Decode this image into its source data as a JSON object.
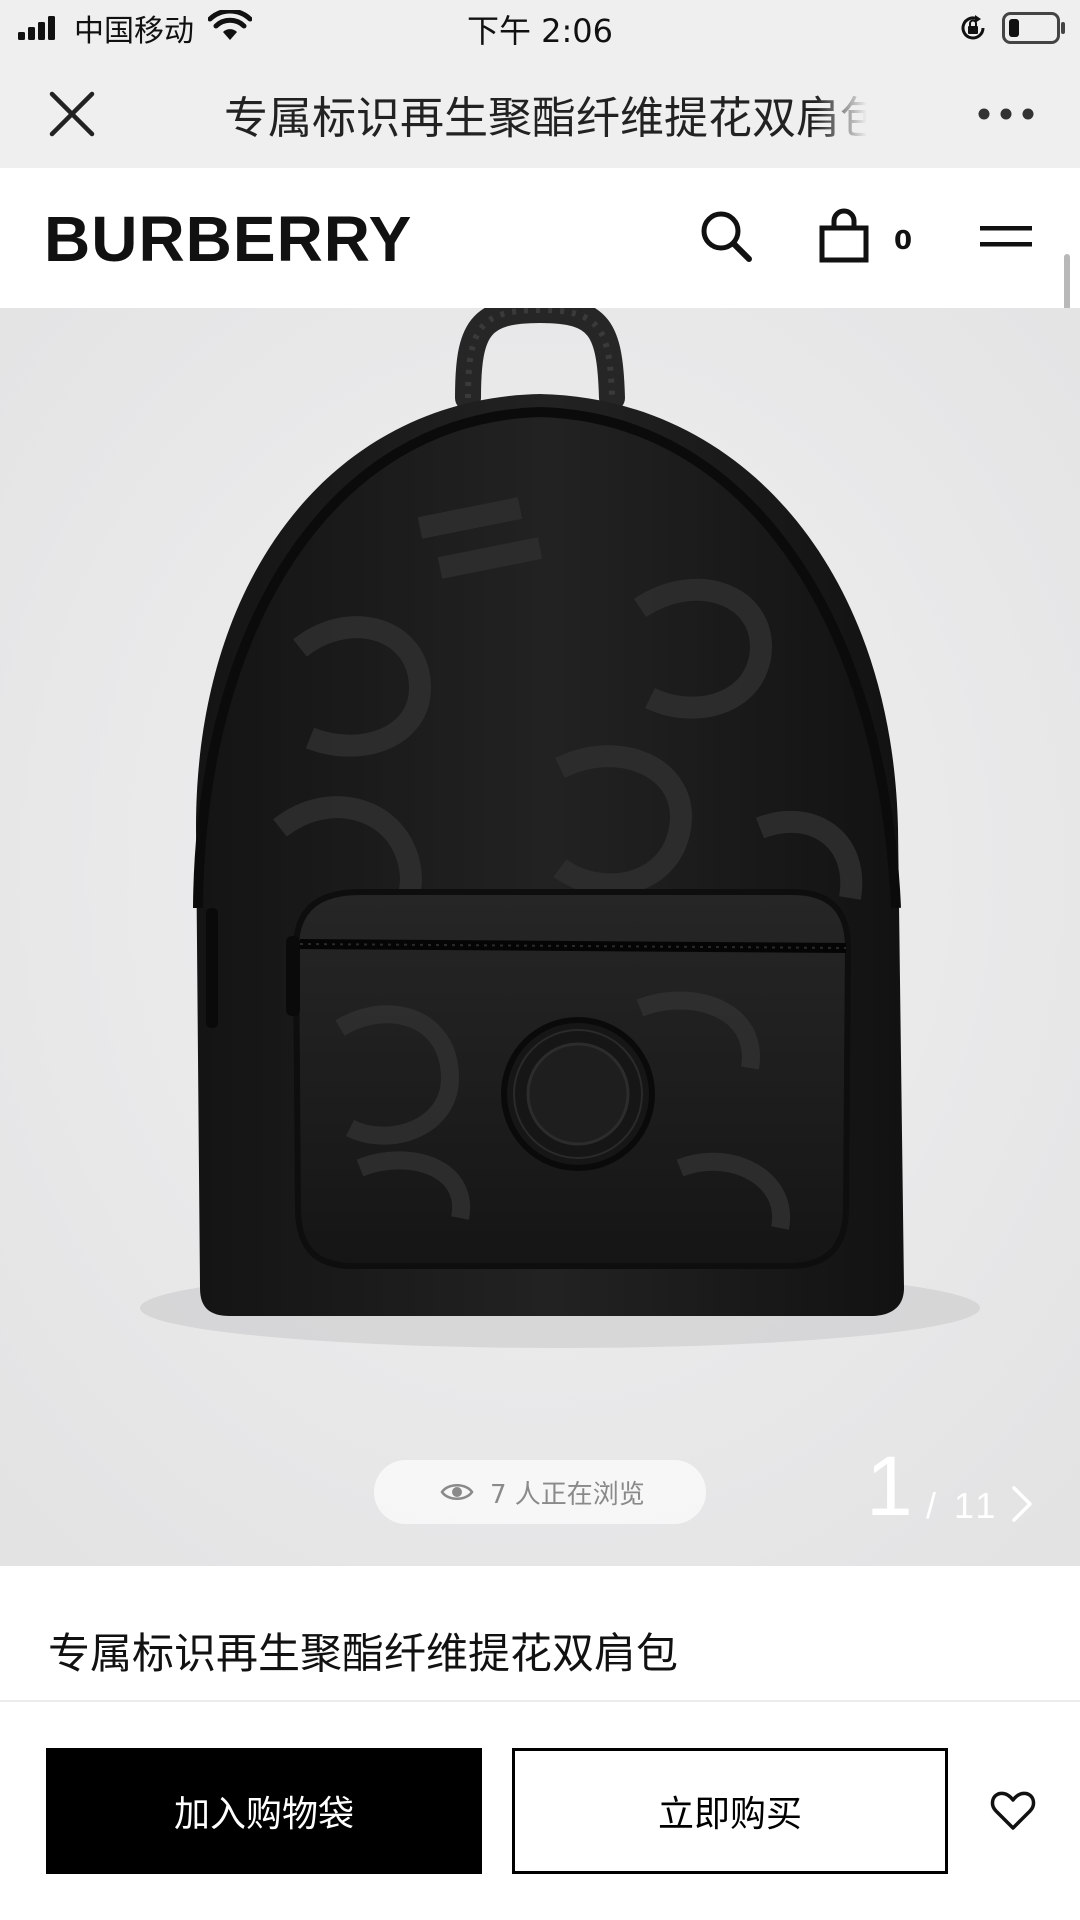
{
  "status_bar": {
    "carrier": "中国移动",
    "time": "下午 2:06"
  },
  "nav": {
    "title": "专属标识再生聚酯纤维提花双肩包"
  },
  "header": {
    "logo": "BURBERRY",
    "bag_count": "0"
  },
  "gallery": {
    "viewers_text": "7 人正在浏览",
    "page_current": "1",
    "page_total": "/ 11"
  },
  "product": {
    "title": "专属标识再生聚酯纤维提花双肩包"
  },
  "actions": {
    "add_to_bag": "加入购物袋",
    "buy_now": "立即购买"
  },
  "icons": {
    "close": "close-icon",
    "more": "more-icon",
    "search": "search-icon",
    "bag": "shopping-bag-icon",
    "menu": "menu-icon",
    "eye": "eye-icon",
    "next": "chevron-right-icon",
    "wishlist": "heart-icon"
  },
  "colors": {
    "bar_background": "#efefef",
    "gallery_background": "#e9e9ea",
    "primary_button": "#000000",
    "product_color": "#1a1a1a"
  }
}
